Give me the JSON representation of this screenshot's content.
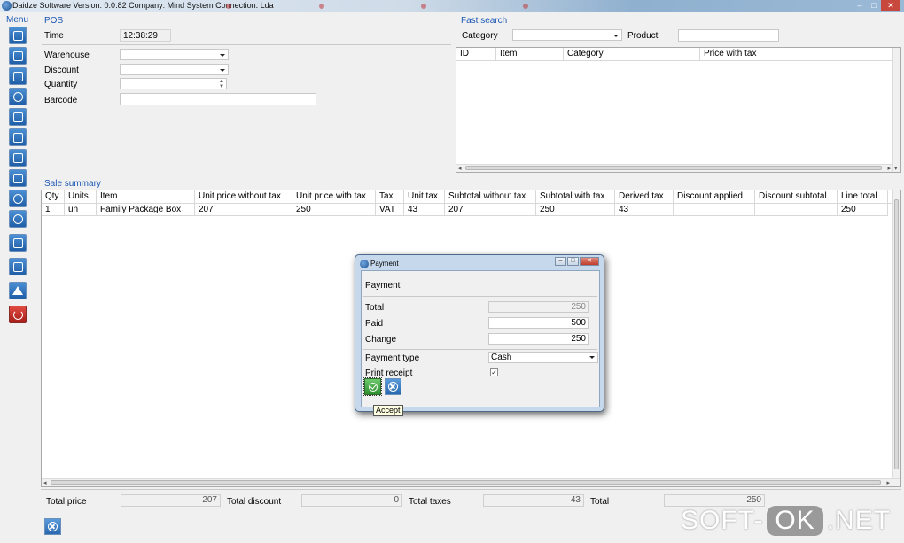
{
  "window": {
    "title": "Daidze Software Version: 0.0.82 Company: Mind System Connection. Lda",
    "controls": {
      "minimize": "–",
      "maximize": "□",
      "close": "✕"
    }
  },
  "menu": {
    "label": "Menu",
    "items": [
      {
        "icon": "register-icon"
      },
      {
        "icon": "document-icon"
      },
      {
        "icon": "cart-icon"
      },
      {
        "icon": "coin-icon"
      },
      {
        "icon": "truck-icon"
      },
      {
        "icon": "contact-icon"
      },
      {
        "icon": "cart-return-icon"
      },
      {
        "icon": "tag-icon"
      },
      {
        "icon": "no-entry-icon"
      },
      {
        "icon": "download-icon"
      },
      {
        "icon": "report-icon"
      },
      {
        "icon": "calculator-icon"
      },
      {
        "icon": "warning-icon"
      },
      {
        "icon": "power-icon"
      }
    ]
  },
  "pos": {
    "label": "POS",
    "time_label": "Time",
    "time_value": "12:38:29",
    "warehouse_label": "Warehouse",
    "discount_label": "Discount",
    "quantity_label": "Quantity",
    "barcode_label": "Barcode"
  },
  "fast_search": {
    "label": "Fast search",
    "category_label": "Category",
    "product_label": "Product",
    "columns": [
      "ID",
      "Item",
      "Category",
      "Price with tax"
    ]
  },
  "sale_summary": {
    "label": "Sale summary",
    "columns": [
      "Qty",
      "Units",
      "Item",
      "Unit price without tax",
      "Unit price with tax",
      "Tax",
      "Unit tax",
      "Subtotal without tax",
      "Subtotal with tax",
      "Derived tax",
      "Discount applied",
      "Discount subtotal",
      "Line total"
    ],
    "rows": [
      [
        "1",
        "un",
        "Family Package Box",
        "207",
        "250",
        "VAT",
        "43",
        "207",
        "250",
        "43",
        "",
        "",
        "250"
      ]
    ]
  },
  "totals": {
    "total_price_label": "Total price",
    "total_price": "207",
    "total_discount_label": "Total discount",
    "total_discount": "0",
    "total_taxes_label": "Total taxes",
    "total_taxes": "43",
    "total_label": "Total",
    "total": "250"
  },
  "payment_dialog": {
    "title": "Payment",
    "header": "Payment",
    "total_label": "Total",
    "total": "250",
    "paid_label": "Paid",
    "paid": "500",
    "change_label": "Change",
    "change": "250",
    "payment_type_label": "Payment type",
    "payment_type": "Cash",
    "print_receipt_label": "Print receipt",
    "print_receipt_checked": true,
    "accept_tooltip": "Accept"
  },
  "watermark": {
    "left": "SOFT-",
    "middle": "OK",
    "right": ".NET"
  }
}
